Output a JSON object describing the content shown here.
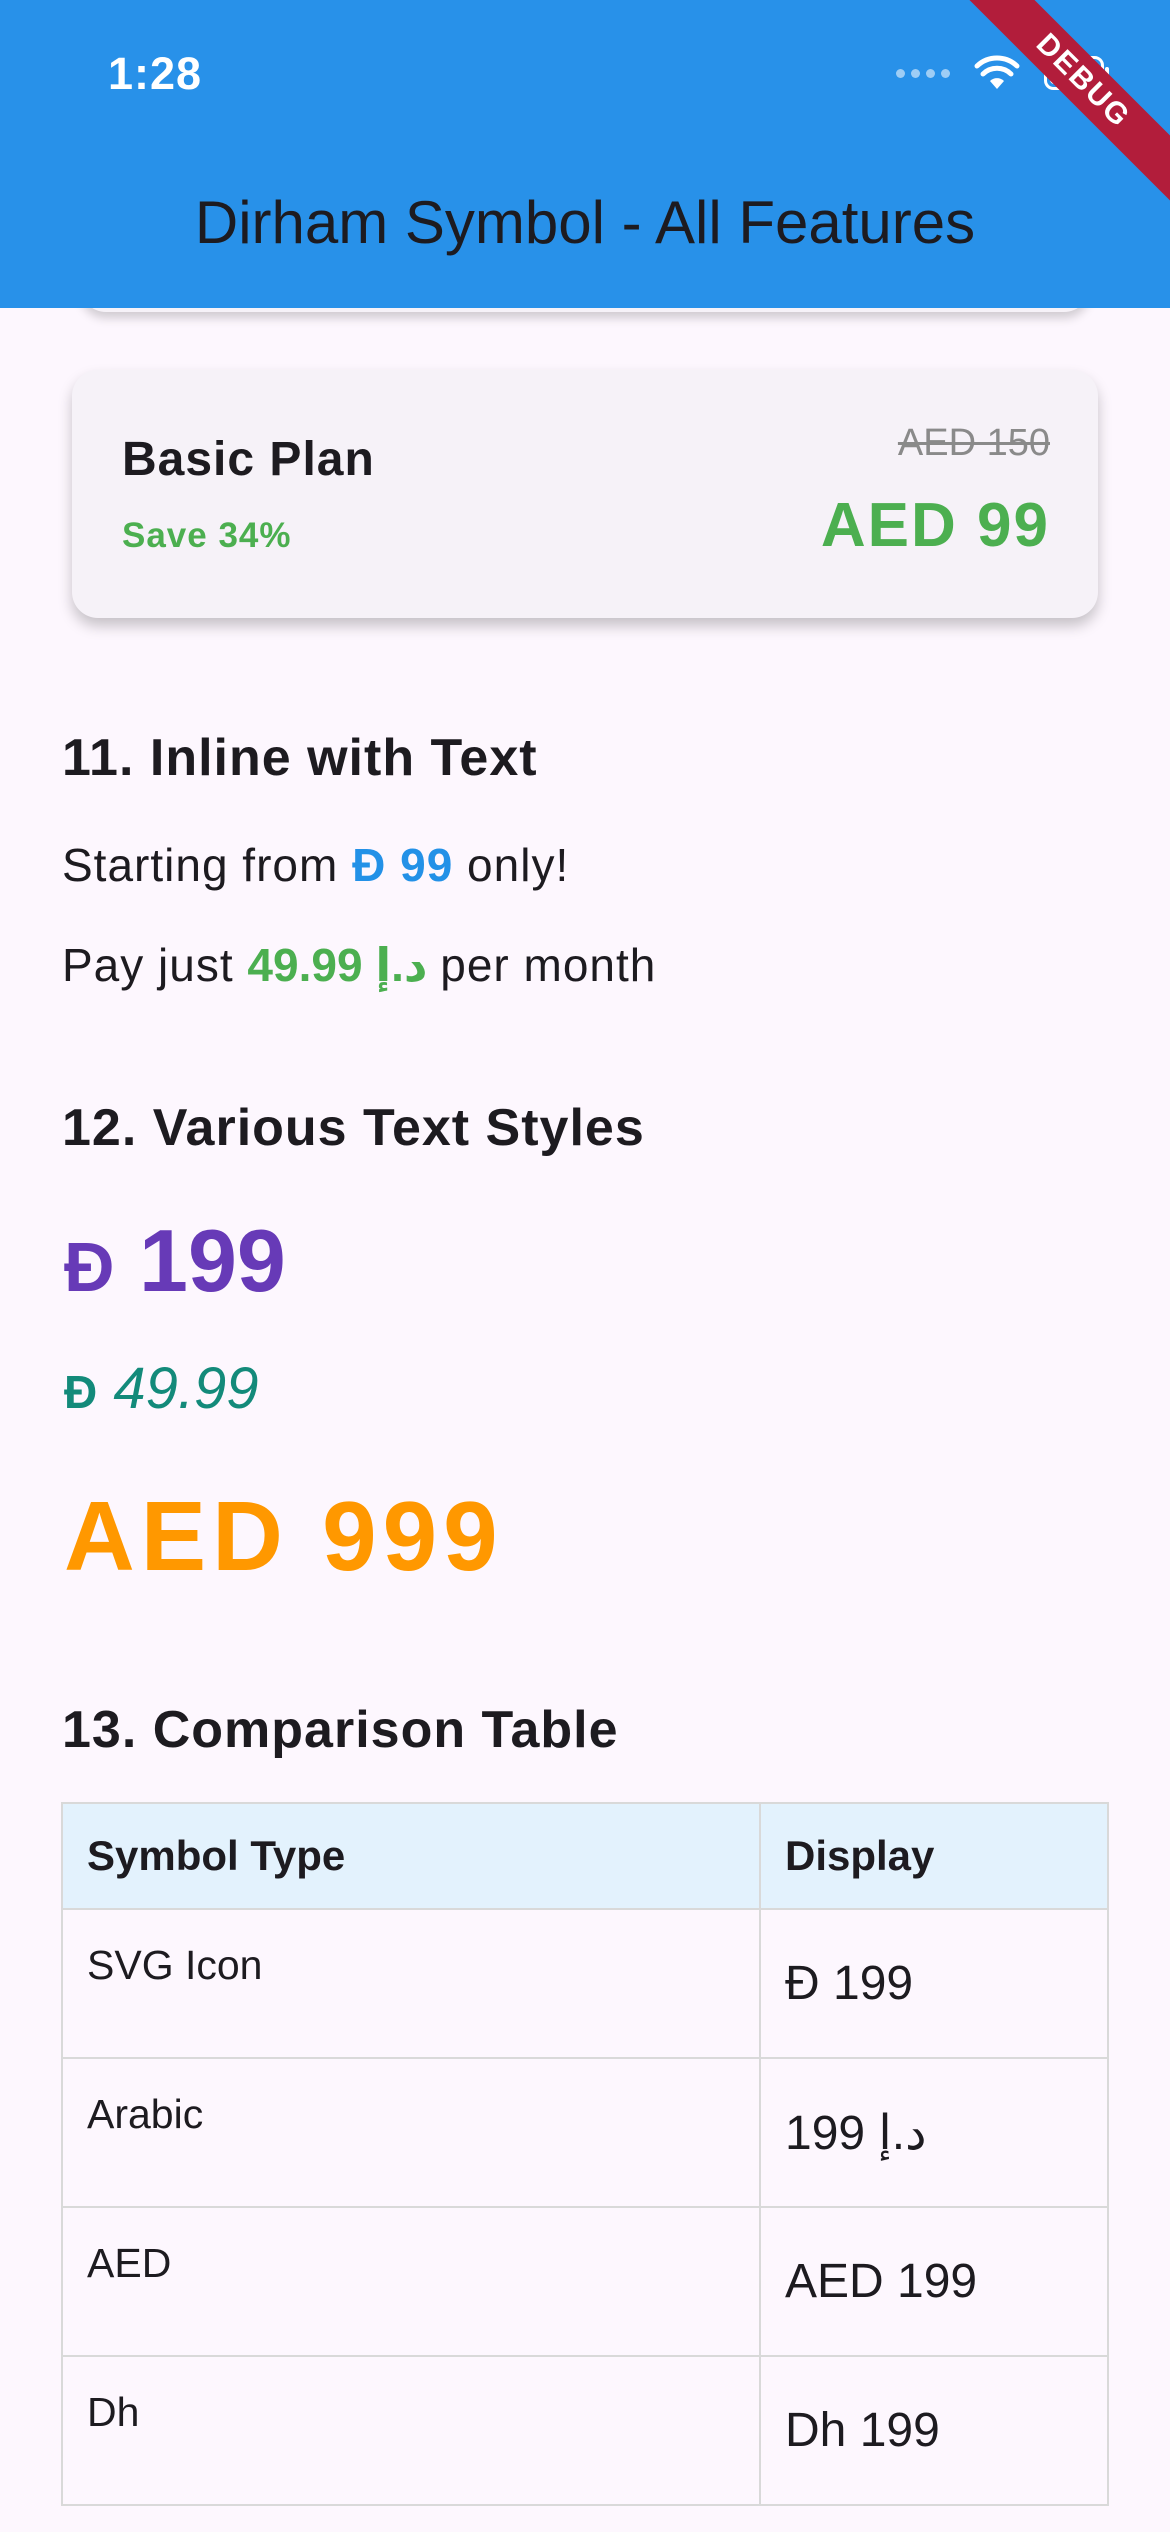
{
  "status_bar": {
    "time": "1:28"
  },
  "app_bar": {
    "title": "Dirham Symbol - All Features",
    "debug_label": "DEBUG"
  },
  "plan_card": {
    "name": "Basic Plan",
    "save": "Save 34%",
    "old_price": "AED 150",
    "price": "AED 99"
  },
  "section11": {
    "title": "11. Inline with Text",
    "line1": {
      "prefix": "Starting from ",
      "symbol": "Đ",
      "amount": "99",
      "suffix": " only!"
    },
    "line2": {
      "prefix": "Pay just ",
      "symbol": "د.إ",
      "amount": "49.99",
      "suffix": " per month"
    }
  },
  "section12": {
    "title": "12. Various Text Styles",
    "purple": {
      "symbol": "Đ",
      "amount": "199"
    },
    "teal": {
      "symbol": "Đ",
      "amount": "49.99"
    },
    "orange": "AED 999"
  },
  "section13": {
    "title": "13. Comparison Table",
    "headers": [
      "Symbol Type",
      "Display"
    ],
    "rows": [
      {
        "type": "SVG Icon",
        "display": "Đ 199"
      },
      {
        "type": "Arabic",
        "display": "د.إ 199"
      },
      {
        "type": "AED",
        "display": "AED 199"
      },
      {
        "type": "Dh",
        "display": "Dh 199"
      }
    ]
  },
  "colors": {
    "app_bar": "#2891e9",
    "green": "#4caf50",
    "blue": "#2391e7",
    "purple": "#673ab7",
    "teal": "#138a7a",
    "orange": "#ff9800",
    "table_header": "#e3f2fd"
  }
}
